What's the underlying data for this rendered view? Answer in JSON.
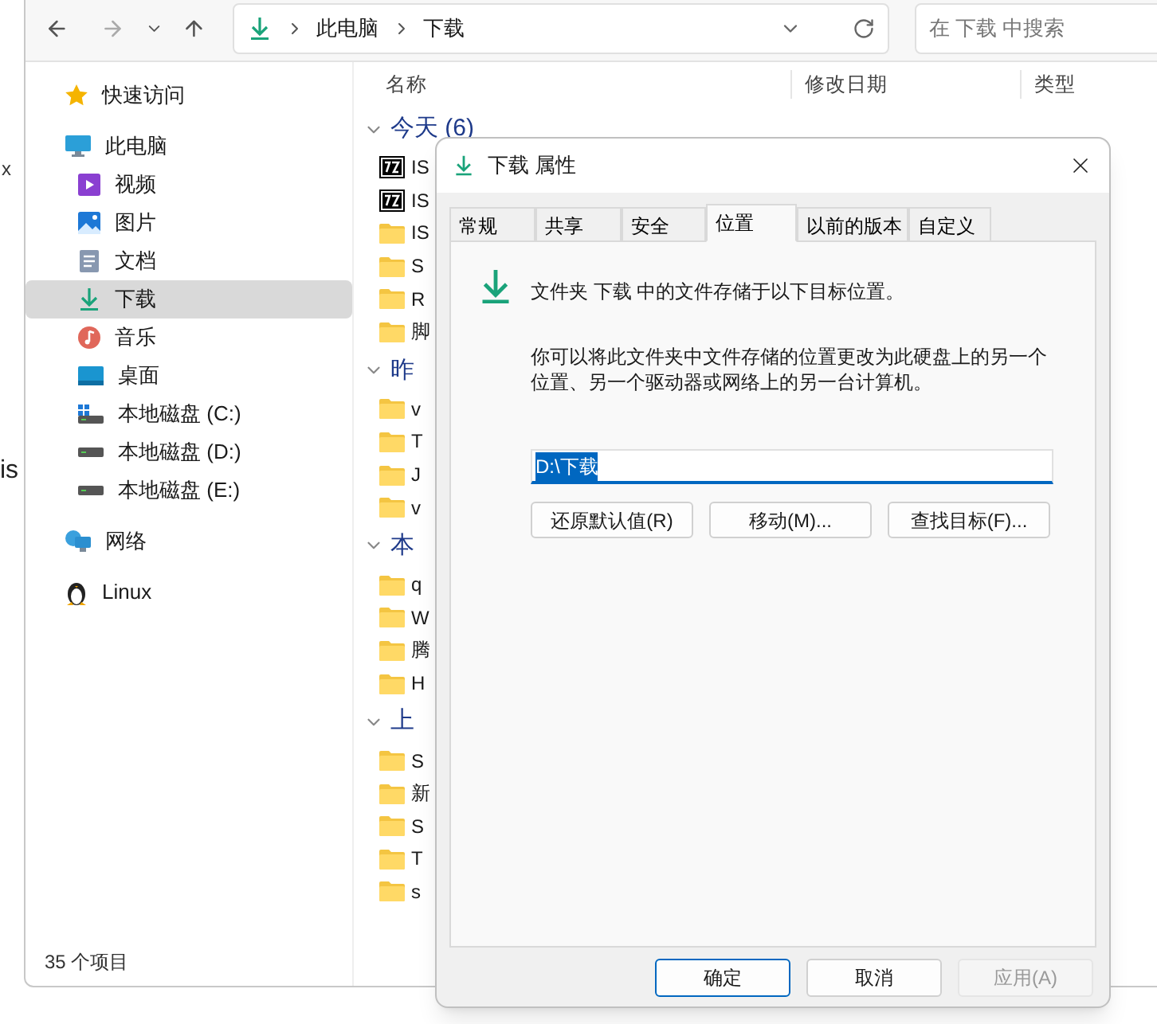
{
  "background_window": {
    "texts": [
      "x",
      "is"
    ]
  },
  "explorer": {
    "address": {
      "path": [
        "此电脑",
        "下载"
      ]
    },
    "search": {
      "placeholder": "在 下载 中搜索"
    },
    "sidebar": {
      "items": [
        {
          "label": "快速访问",
          "kind": "star",
          "selected": false
        },
        {
          "label": "此电脑",
          "kind": "pc",
          "selected": false,
          "children": [
            {
              "label": "视频",
              "kind": "video",
              "selected": false
            },
            {
              "label": "图片",
              "kind": "image",
              "selected": false
            },
            {
              "label": "文档",
              "kind": "doc",
              "selected": false
            },
            {
              "label": "下载",
              "kind": "download",
              "selected": true
            },
            {
              "label": "音乐",
              "kind": "music",
              "selected": false
            },
            {
              "label": "桌面",
              "kind": "desktop",
              "selected": false
            },
            {
              "label": "本地磁盘 (C:)",
              "kind": "sysdrive",
              "selected": false
            },
            {
              "label": "本地磁盘 (D:)",
              "kind": "drive",
              "selected": false
            },
            {
              "label": "本地磁盘 (E:)",
              "kind": "drive",
              "selected": false
            }
          ]
        },
        {
          "label": "网络",
          "kind": "network",
          "selected": false
        },
        {
          "label": "Linux",
          "kind": "linux",
          "selected": false
        }
      ]
    },
    "columns": [
      "名称",
      "修改日期",
      "类型"
    ],
    "groups": [
      {
        "label": "今天 (6)",
        "files": [
          {
            "name": "IS",
            "kind": "archive"
          },
          {
            "name": "IS",
            "kind": "archive"
          },
          {
            "name": "IS",
            "kind": "folder"
          },
          {
            "name": "S",
            "kind": "folder"
          },
          {
            "name": "R",
            "kind": "folder"
          },
          {
            "name": "脚",
            "kind": "folder"
          }
        ]
      },
      {
        "label": "昨",
        "files": [
          {
            "name": "v",
            "kind": "folder"
          },
          {
            "name": "T",
            "kind": "folder"
          },
          {
            "name": "J",
            "kind": "folder"
          },
          {
            "name": "v",
            "kind": "folder"
          }
        ]
      },
      {
        "label": "本",
        "files": [
          {
            "name": "q",
            "kind": "folder"
          },
          {
            "name": "W",
            "kind": "folder"
          },
          {
            "name": "腾",
            "kind": "folder"
          },
          {
            "name": "H",
            "kind": "folder"
          }
        ]
      },
      {
        "label": "上",
        "files": [
          {
            "name": "S",
            "kind": "folder"
          },
          {
            "name": "新",
            "kind": "folder"
          },
          {
            "name": "S",
            "kind": "folder"
          },
          {
            "name": "T",
            "kind": "folder"
          },
          {
            "name": "s",
            "kind": "folder"
          }
        ]
      }
    ],
    "status_bar": "35 个项目"
  },
  "dialog": {
    "title": "下载 属性",
    "tabs": [
      {
        "label": "常规",
        "selected": false
      },
      {
        "label": "共享",
        "selected": false
      },
      {
        "label": "安全",
        "selected": false
      },
      {
        "label": "位置",
        "selected": true
      },
      {
        "label": "以前的版本",
        "selected": false
      },
      {
        "label": "自定义",
        "selected": false
      }
    ],
    "description": "文件夹 下载 中的文件存储于以下目标位置。",
    "help_text": "你可以将此文件夹中文件存储的位置更改为此硬盘上的另一个位置、另一个驱动器或网络上的另一台计算机。",
    "location": {
      "value": "D:\\下载",
      "selected": true
    },
    "location_buttons": [
      "还原默认值(R)",
      "移动(M)...",
      "查找目标(F)..."
    ],
    "buttons": [
      {
        "label": "确定",
        "kind": "primary",
        "disabled": false
      },
      {
        "label": "取消",
        "kind": "normal",
        "disabled": false
      },
      {
        "label": "应用(A)",
        "kind": "normal",
        "disabled": true
      }
    ]
  }
}
